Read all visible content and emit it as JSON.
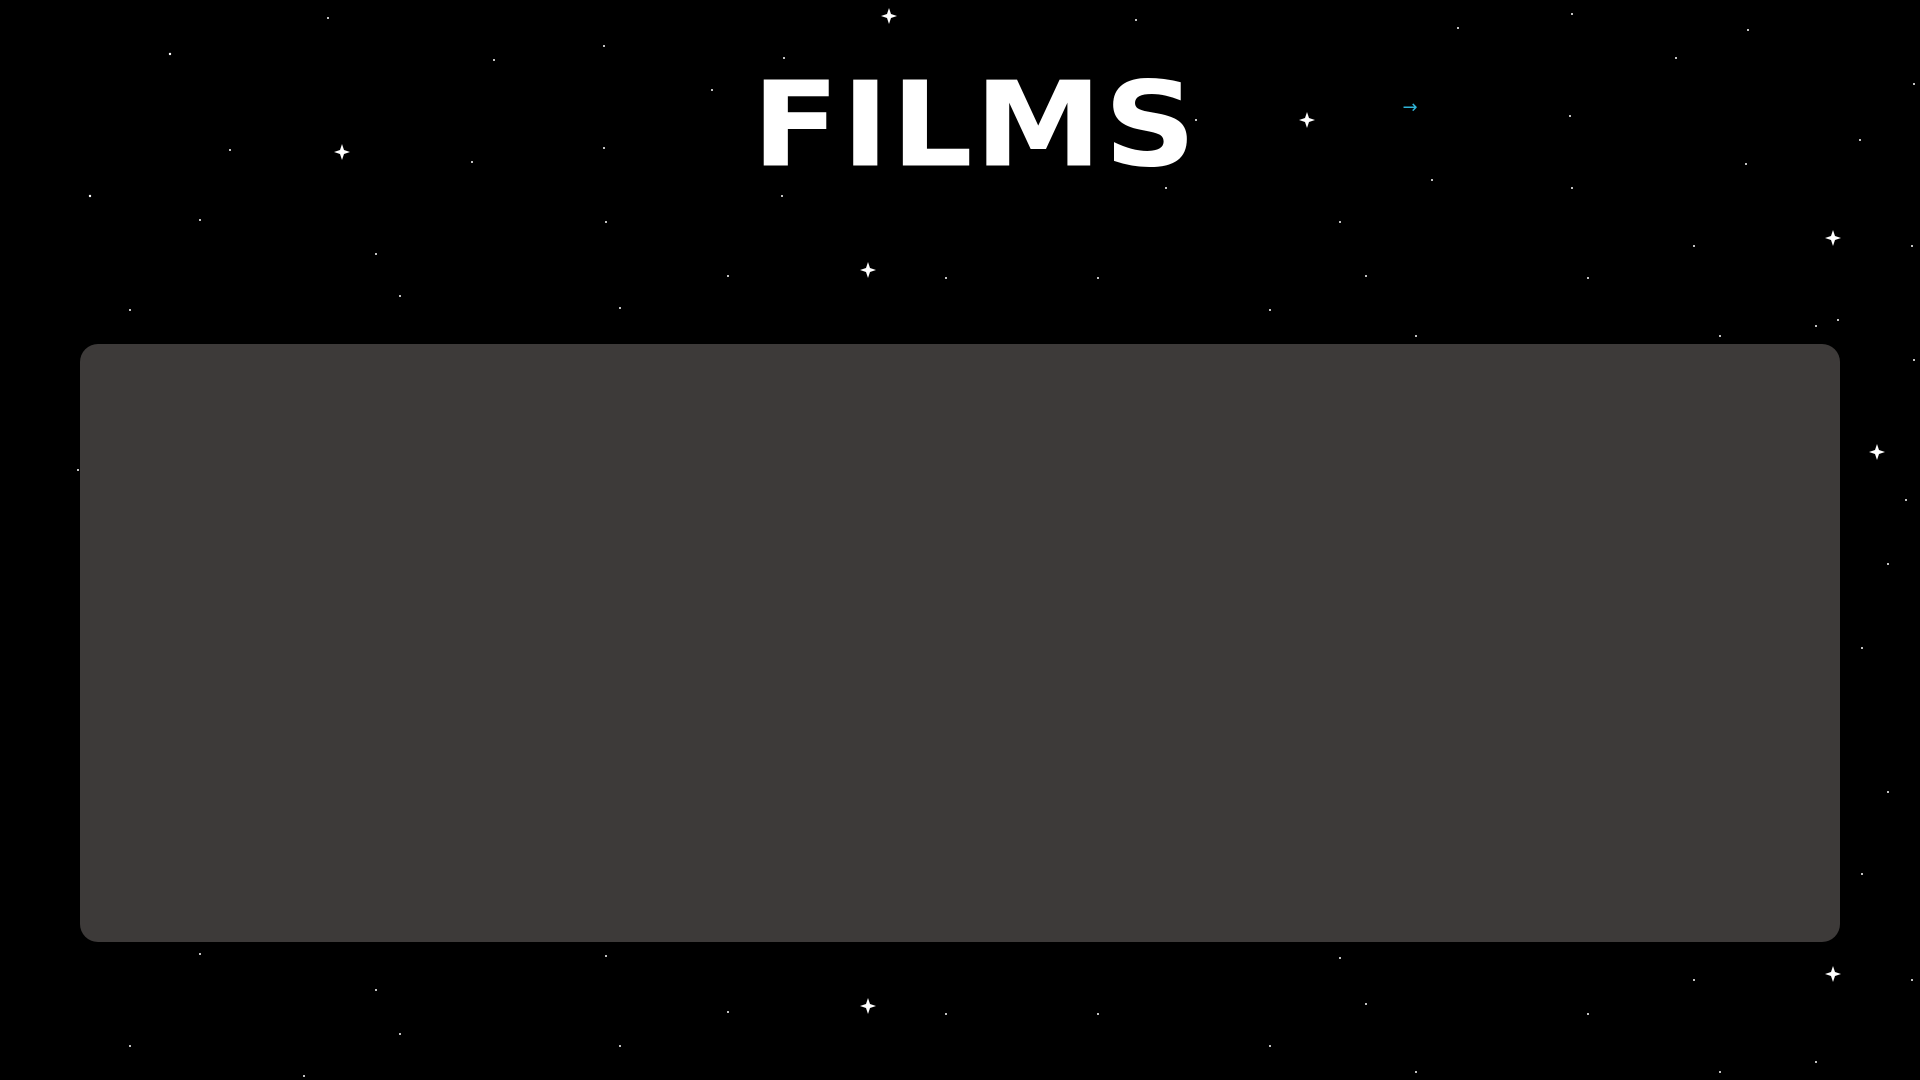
{
  "header": {
    "title": "FILMS",
    "next_icon": "arrow-right-icon",
    "next_glyph": "→"
  },
  "main": {
    "panel": {
      "content": ""
    }
  },
  "colors": {
    "background": "#000000",
    "panel": "#3d3a39",
    "title": "#ffffff",
    "accent": "#2fb4d8"
  }
}
